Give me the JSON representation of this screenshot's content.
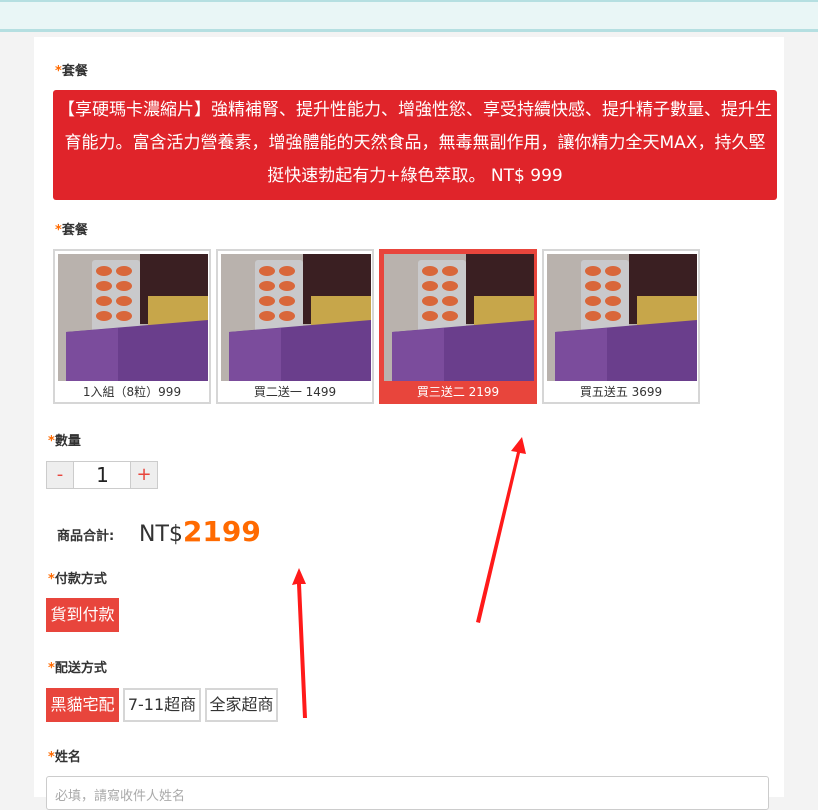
{
  "form": {
    "required_mark": "*",
    "package_label_1": "套餐",
    "description": "【享硬瑪卡濃縮片】強精補腎、提升性能力、增強性慾、享受持續快感、提升精子數量、提升生育能力。富含活力營養素，增強體能的天然食品，無毒無副作用，讓你精力全天MAX，持久堅挺快速勃起有力+綠色萃取。 NT$ 999",
    "package_label_2": "套餐",
    "packages": [
      {
        "label": "1入組（8粒）999",
        "selected": false
      },
      {
        "label": "買二送一 1499",
        "selected": false
      },
      {
        "label": "買三送二 2199",
        "selected": true
      },
      {
        "label": "買五送五 3699",
        "selected": false
      }
    ],
    "quantity_label": "數量",
    "quantity": {
      "minus": "-",
      "value": "1",
      "plus": "+"
    },
    "total_label": "商品合計:",
    "total_currency": "NT$",
    "total_amount": "2199",
    "payment_label": "付款方式",
    "payment_options": [
      "貨到付款"
    ],
    "shipping_label": "配送方式",
    "shipping_options": [
      "黑貓宅配",
      "7-11超商",
      "全家超商"
    ],
    "name_label": "姓名",
    "name_placeholder": "必填，請寫收件人姓名"
  },
  "colors": {
    "accent_red": "#e8453c",
    "banner_red": "#e0242a",
    "price_orange": "#ff6a00",
    "arrow_red": "#ff1a1a"
  }
}
